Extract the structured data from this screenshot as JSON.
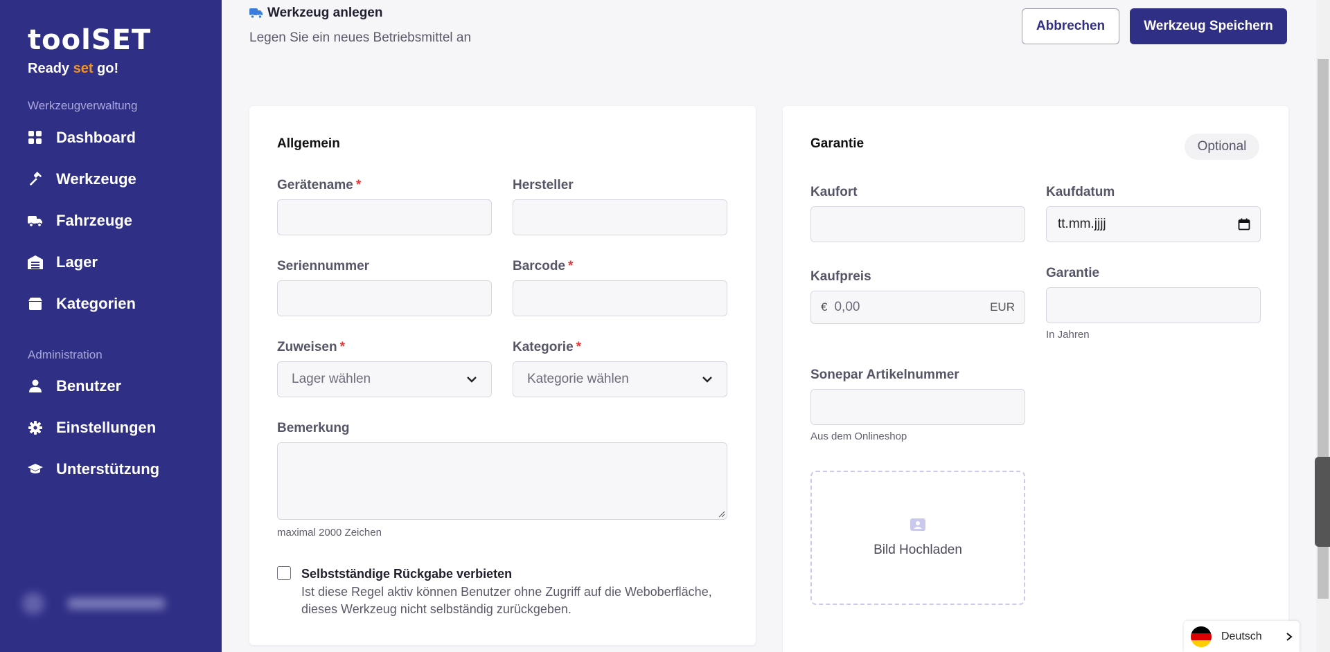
{
  "brand": {
    "logo": "toolSET",
    "tagline_a": "Ready ",
    "tagline_accent": "set",
    "tagline_b": " go!"
  },
  "sidebar": {
    "section1": "Werkzeugverwaltung",
    "items1": [
      {
        "label": "Dashboard",
        "icon": "dashboard-icon"
      },
      {
        "label": "Werkzeuge",
        "icon": "hammer-icon"
      },
      {
        "label": "Fahrzeuge",
        "icon": "truck-icon"
      },
      {
        "label": "Lager",
        "icon": "warehouse-icon"
      },
      {
        "label": "Kategorien",
        "icon": "box-icon"
      }
    ],
    "section2": "Administration",
    "items2": [
      {
        "label": "Benutzer",
        "icon": "user-icon"
      },
      {
        "label": "Einstellungen",
        "icon": "gear-icon"
      },
      {
        "label": "Unterstützung",
        "icon": "graduation-cap-icon"
      }
    ]
  },
  "header": {
    "title": "Werkzeug anlegen",
    "subtitle": "Legen Sie ein neues Betriebsmittel an",
    "cancel": "Abbrechen",
    "save": "Werkzeug Speichern"
  },
  "general": {
    "title": "Allgemein",
    "geraetename": "Gerätename",
    "hersteller": "Hersteller",
    "seriennummer": "Seriennummer",
    "barcode": "Barcode",
    "zuweisen": "Zuweisen",
    "zuweisen_value": "Lager wählen",
    "kategorie": "Kategorie",
    "kategorie_value": "Kategorie wählen",
    "required_mark": "*",
    "bemerkung": "Bemerkung",
    "bemerkung_hint": "maximal 2000 Zeichen",
    "checkbox_title": "Selbstständige Rückgabe verbieten",
    "checkbox_desc": "Ist diese Regel aktiv können Benutzer ohne Zugriff auf die Weboberfläche, dieses Werkzeug nicht selbständig zurückgeben."
  },
  "warranty": {
    "title": "Garantie",
    "badge": "Optional",
    "kaufort": "Kaufort",
    "kaufdatum": "Kaufdatum",
    "kaufdatum_value": "tt.mm.jjjj",
    "kaufpreis": "Kaufpreis",
    "currency_symbol": "€",
    "price_placeholder": "0,00",
    "currency_unit": "EUR",
    "garantie": "Garantie",
    "garantie_hint": "In Jahren",
    "sonepar": "Sonepar Artikelnummer",
    "sonepar_hint": "Aus dem Onlineshop",
    "upload": "Bild Hochladen"
  },
  "language": {
    "label": "Deutsch"
  },
  "colors": {
    "sidebar": "#302f86",
    "accent": "#f39321",
    "primary": "#302f86",
    "required": "#e03b3b"
  }
}
